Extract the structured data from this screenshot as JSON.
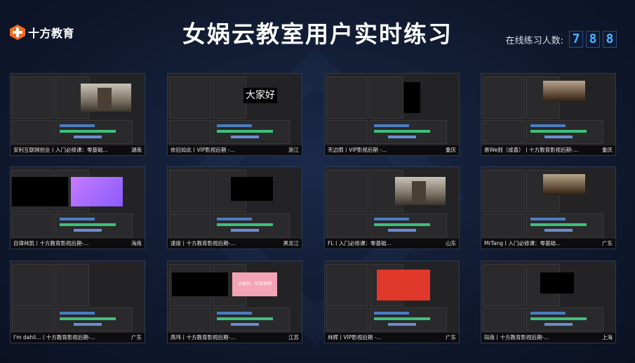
{
  "header": {
    "logo_text": "十方教育",
    "title": "女娲云教室用户实时练习",
    "counter_label": "在线练习人数:",
    "counter_digits": [
      "7",
      "8",
      "8"
    ]
  },
  "colors": {
    "accent_orange": "#f26b1d",
    "counter_blue": "#4fb3ff",
    "timeline_green": "#3ec07a",
    "timeline_pink": "#e066b8"
  },
  "tiles": [
    {
      "name": "安利互联网创业丨入门必修课：零基础...",
      "location": "湖南",
      "preview": "landscape"
    },
    {
      "name": "依旧如此丨VIP影视后期 -...",
      "location": "浙江",
      "preview": "text_dajia"
    },
    {
      "name": "天边雨丨VIP影视后期 -...",
      "location": "重庆",
      "preview": "black_portrait"
    },
    {
      "name": "易We则（成香）丨十方教育影视后期-...",
      "location": "重庆",
      "preview": "landscape_small"
    },
    {
      "name": "自律林凯丨十方教育影视后期-...",
      "location": "海南",
      "preview": "purple_title"
    },
    {
      "name": "速度丨十方教育影视后期-...",
      "location": "黑龙江",
      "preview": "black"
    },
    {
      "name": "FL丨入门必修课：零基础...",
      "location": "山东",
      "preview": "landscape"
    },
    {
      "name": "MrTang丨入门必修课：零基础...",
      "location": "广东",
      "preview": "landscape_small"
    },
    {
      "name": "I'm dahli...丨十方教育影视后期-...",
      "location": "广东",
      "preview": "empty"
    },
    {
      "name": "燕玮丨十方教育影视后期-...",
      "location": "江苏",
      "preview": "pink_title"
    },
    {
      "name": "林辉丨VIP影视后期 -...",
      "location": "广东",
      "preview": "red"
    },
    {
      "name": "知南丨十方教育影视后期-...",
      "location": "上海",
      "preview": "black_small"
    }
  ],
  "preview_texts": {
    "dajia": "大家好",
    "pink_title": "大家好，欢迎来到"
  }
}
